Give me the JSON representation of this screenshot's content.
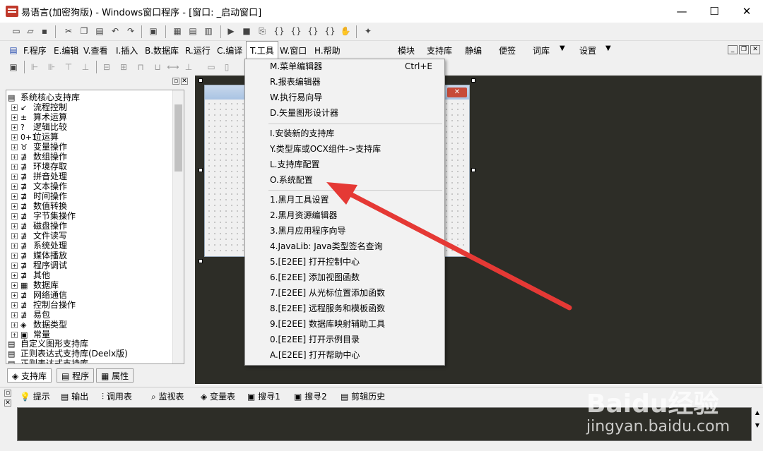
{
  "window": {
    "title": "易语言(加密狗版) - Windows窗口程序 - [窗口: _启动窗口]"
  },
  "window_controls": {
    "minimize": "—",
    "maximize": "☐",
    "close": "✕"
  },
  "menubar": {
    "items": [
      "F.程序",
      "E.编辑",
      "V.查看",
      "I.插入",
      "B.数据库",
      "R.运行",
      "C.编译",
      "T.工具",
      "W.窗口",
      "H.帮助"
    ],
    "right_items": [
      "模块",
      "支持库",
      "静编",
      "便签",
      "词库",
      "设置"
    ]
  },
  "left_panel": {
    "root": "系统核心支持库",
    "nodes": [
      "流程控制",
      "算术运算",
      "逻辑比较",
      "位运算",
      "变量操作",
      "数组操作",
      "环境存取",
      "拼音处理",
      "文本操作",
      "时间操作",
      "数值转换",
      "字节集操作",
      "磁盘操作",
      "文件读写",
      "系统处理",
      "媒体播放",
      "程序调试",
      "其他",
      "数据库",
      "网络通信",
      "控制台操作",
      "易包",
      "数据类型",
      "常量"
    ],
    "extra_roots": [
      "自定义图形支持库",
      "正则表达式支持库(Deelx版)",
      "正则表达式支持库"
    ],
    "tabs": [
      "支持库",
      "程序",
      "属性"
    ]
  },
  "tools_menu": {
    "group1": [
      {
        "label": "M.菜单编辑器",
        "shortcut": "Ctrl+E"
      },
      {
        "label": "R.报表编辑器",
        "shortcut": ""
      },
      {
        "label": "W.执行易向导",
        "shortcut": ""
      },
      {
        "label": "D.矢量图形设计器",
        "shortcut": ""
      }
    ],
    "group2": [
      "I.安装新的支持库",
      "Y.类型库或OCX组件->支持库",
      "L.支持库配置",
      "O.系统配置"
    ],
    "group3": [
      "1.黑月工具设置",
      "2.黑月资源编辑器",
      "3.黑月应用程序向导",
      "4.JavaLib: Java类型签名查询",
      "5.[E2EE] 打开控制中心",
      "6.[E2EE] 添加视图函数",
      "7.[E2EE] 从光标位置添加函数",
      "8.[E2EE] 远程服务和模板函数",
      "9.[E2EE] 数据库映射辅助工具",
      "0.[E2EE] 打开示例目录",
      "A.[E2EE] 打开帮助中心"
    ]
  },
  "bottom_tabs": [
    "提示",
    "输出",
    "调用表",
    "监视表",
    "变量表",
    "搜寻1",
    "搜寻2",
    "剪辑历史"
  ],
  "watermark": {
    "brand": "Baidu经验",
    "url": "jingyan.baidu.com"
  },
  "colors": {
    "accent_arrow": "#e53935",
    "design_bg": "#2d2d27"
  }
}
